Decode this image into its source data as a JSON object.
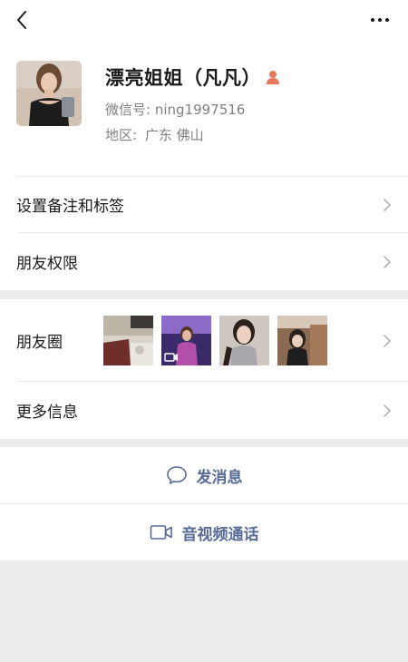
{
  "profile": {
    "name": "漂亮姐姐（凡凡）",
    "wechat_id_label": "微信号:",
    "wechat_id": "ning1997516",
    "region_label": "地区:",
    "region_value": "广东  佛山"
  },
  "menu": {
    "remark_tags": "设置备注和标签",
    "friend_permissions": "朋友权限",
    "moments": "朋友圈",
    "more_info": "更多信息"
  },
  "actions": {
    "send_message": "发消息",
    "video_call": "音视频通话"
  },
  "icons": {
    "back": "chevron-left-icon",
    "more": "more-dots-icon",
    "gender": "female-icon",
    "chevron": "chevron-right-icon",
    "message": "chat-bubble-icon",
    "video": "video-camera-icon"
  },
  "colors": {
    "link_blue": "#576b95",
    "female_badge": "#e8785c",
    "background": "#ededed"
  }
}
